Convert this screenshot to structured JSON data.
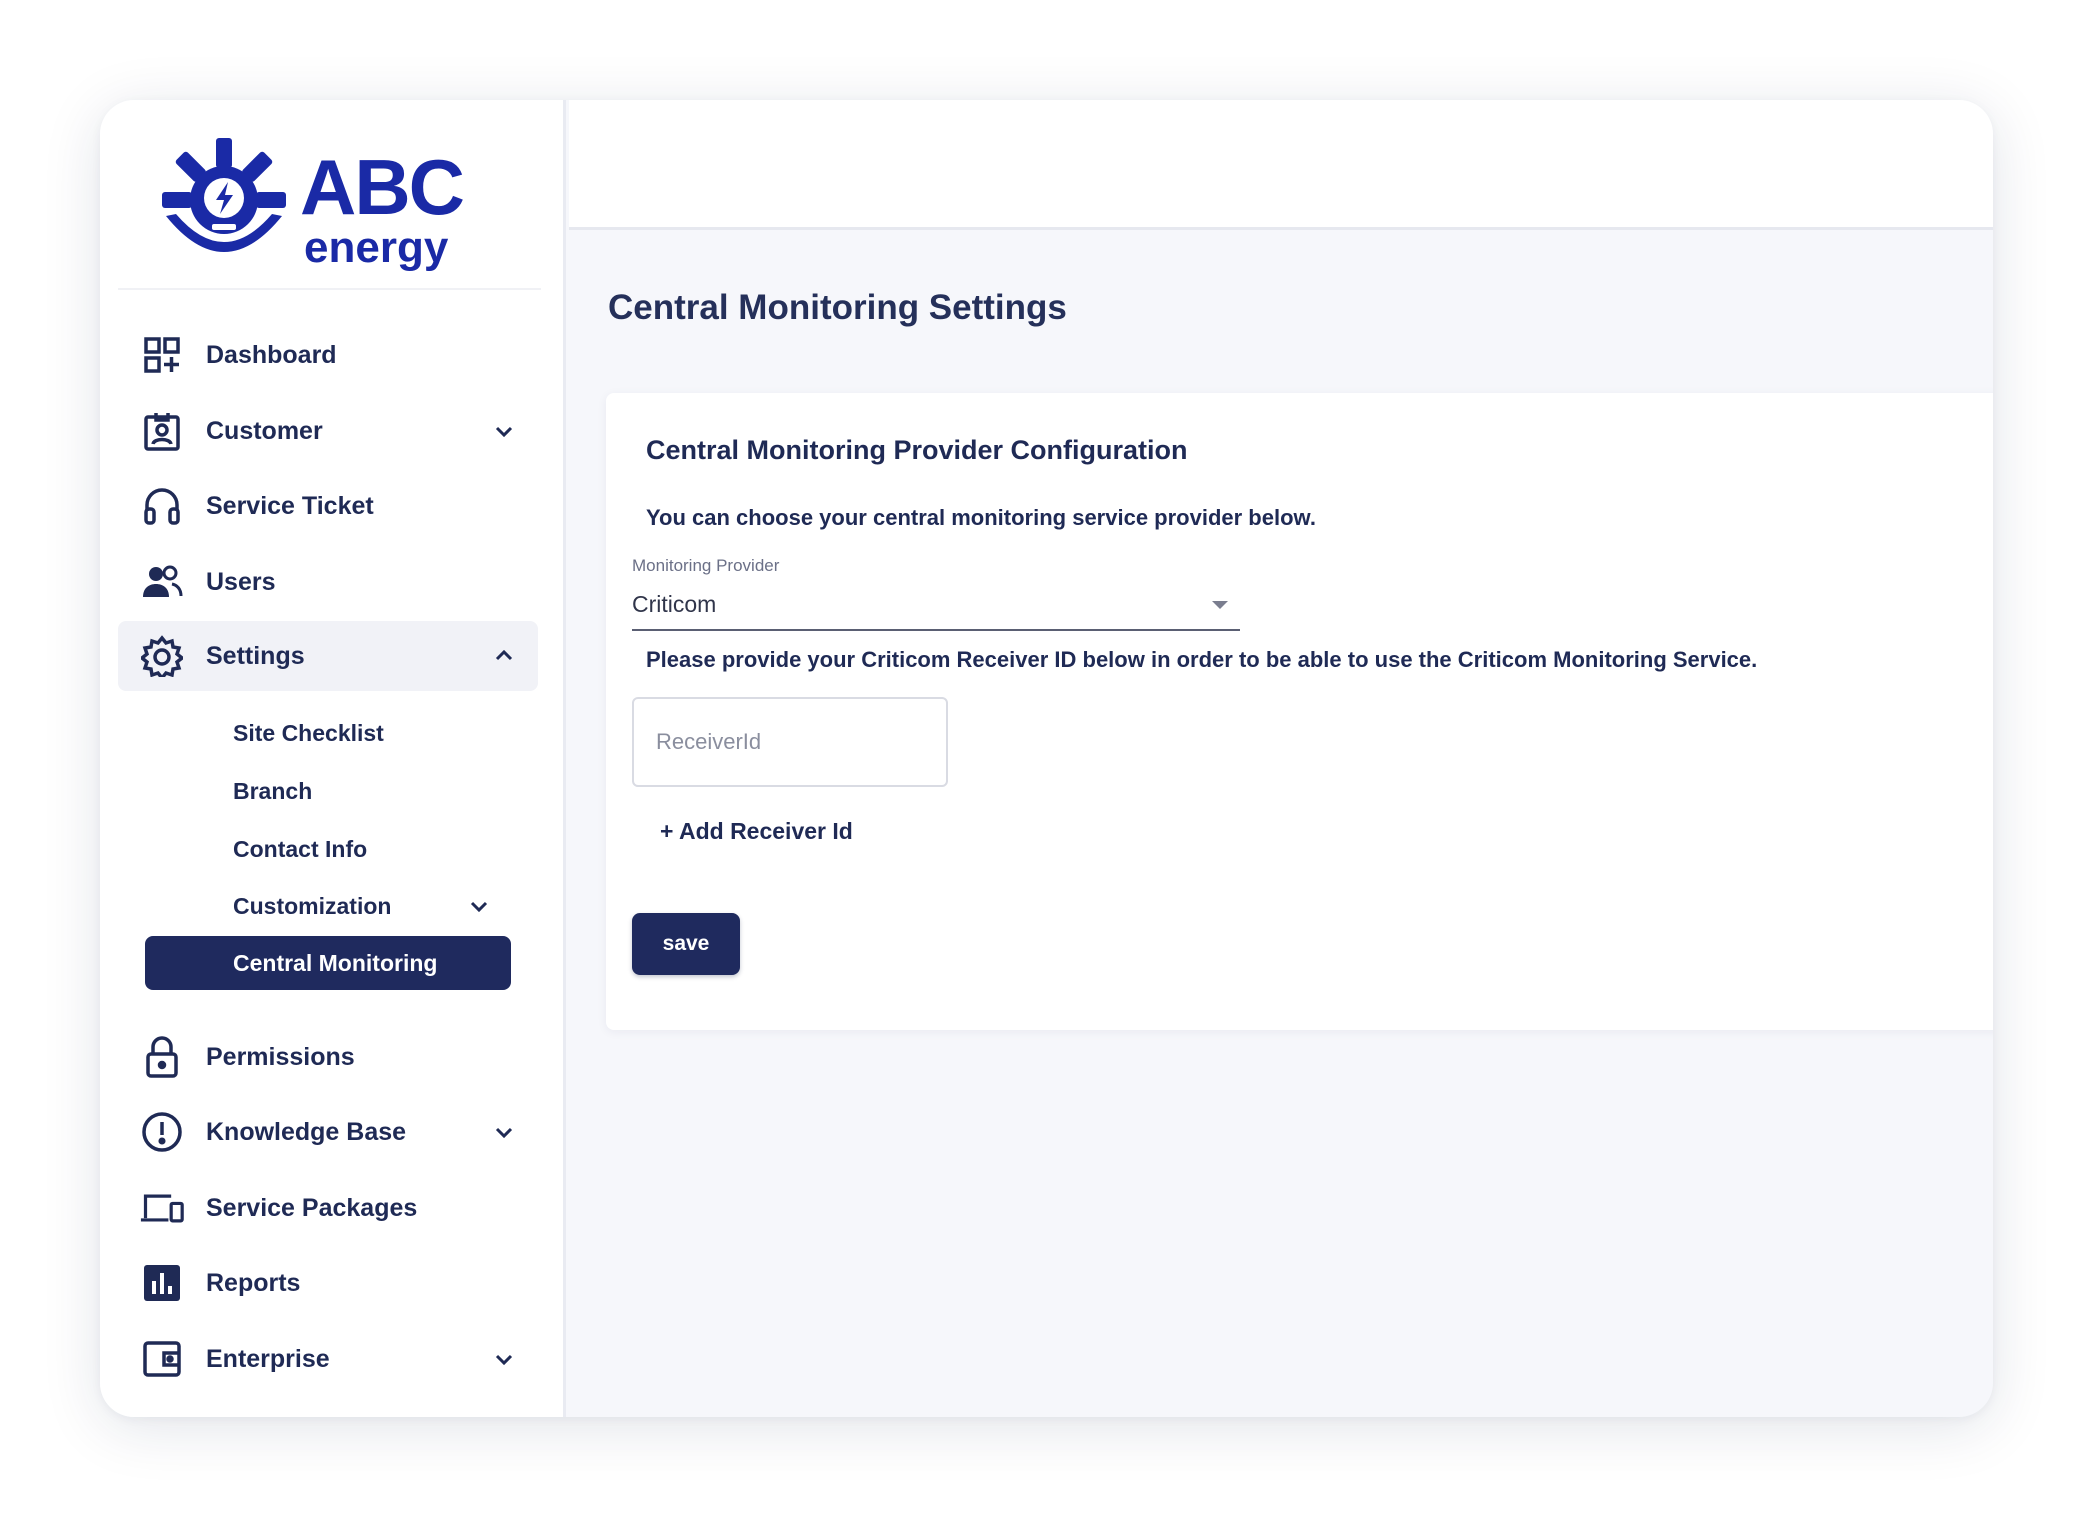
{
  "brand": {
    "name_line1": "ABC",
    "name_line2": "energy",
    "color": "#1a2aa6"
  },
  "sidebar": {
    "items": [
      {
        "label": "Dashboard",
        "icon": "dashboard-grid-icon"
      },
      {
        "label": "Customer",
        "icon": "id-badge-icon",
        "expandable": true,
        "expanded": false
      },
      {
        "label": "Service Ticket",
        "icon": "headset-icon"
      },
      {
        "label": "Users",
        "icon": "users-icon"
      },
      {
        "label": "Settings",
        "icon": "gear-icon",
        "expandable": true,
        "expanded": true
      },
      {
        "label": "Permissions",
        "icon": "lock-icon"
      },
      {
        "label": "Knowledge Base",
        "icon": "exclamation-circle-icon",
        "expandable": true,
        "expanded": false
      },
      {
        "label": "Service Packages",
        "icon": "devices-icon"
      },
      {
        "label": "Reports",
        "icon": "bar-chart-icon"
      },
      {
        "label": "Enterprise",
        "icon": "wallet-icon",
        "expandable": true,
        "expanded": false
      }
    ],
    "settings_subitems": [
      {
        "label": "Site Checklist"
      },
      {
        "label": "Branch"
      },
      {
        "label": "Contact Info"
      },
      {
        "label": "Customization",
        "expandable": true
      },
      {
        "label": "Central Monitoring",
        "active": true
      }
    ],
    "active_color": "#1f2a5e"
  },
  "main": {
    "page_title": "Central Monitoring Settings",
    "card": {
      "title": "Central Monitoring Provider Configuration",
      "description": "You can choose your central monitoring service provider below.",
      "provider_select": {
        "label": "Monitoring Provider",
        "value": "Criticom"
      },
      "note": "Please provide your Criticom Receiver ID below in order to be able to use the Criticom Monitoring Service.",
      "receiver_input": {
        "placeholder": "ReceiverId",
        "value": ""
      },
      "add_receiver_label": "+ Add Receiver Id",
      "save_label": "save"
    }
  }
}
